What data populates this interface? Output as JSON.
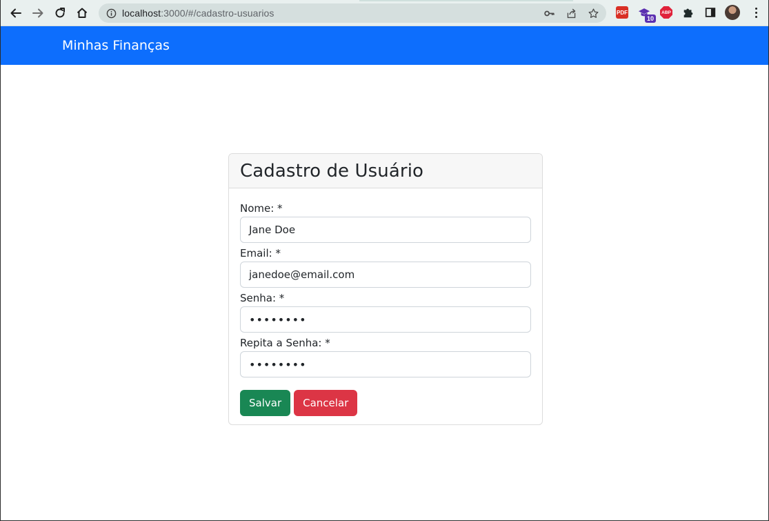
{
  "browser": {
    "url_host": "localhost",
    "url_path": ":3000/#/cadastro-usuarios",
    "extensions": {
      "red_ext_label": "PDF",
      "badge_count": "10",
      "abp_label": "ABP"
    }
  },
  "navbar": {
    "brand": "Minhas Finanças"
  },
  "form": {
    "title": "Cadastro de Usuário",
    "fields": [
      {
        "label": "Nome: *",
        "value": "Jane Doe"
      },
      {
        "label": "Email: *",
        "value": "janedoe@email.com"
      },
      {
        "label": "Senha: *",
        "value": "••••••••"
      },
      {
        "label": "Repita a Senha: *",
        "value": "••••••••"
      }
    ],
    "save_label": "Salvar",
    "cancel_label": "Cancelar"
  },
  "colors": {
    "navbar": "#0d6efd",
    "success": "#198754",
    "danger": "#dc3545"
  }
}
